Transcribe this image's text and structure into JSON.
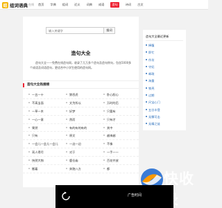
{
  "header": {
    "logo_mark": "组",
    "logo_text": "组词语典",
    "logo_sub": "在线",
    "nav": [
      {
        "label": "首页",
        "active": false
      },
      {
        "label": "字典",
        "active": false
      },
      {
        "label": "组词",
        "active": false
      },
      {
        "label": "近义",
        "active": false
      },
      {
        "label": "词典",
        "active": false
      },
      {
        "label": "成语",
        "active": false
      },
      {
        "label": "造句",
        "active": true
      },
      {
        "label": "诗词",
        "active": false
      },
      {
        "label": "古文",
        "active": false
      }
    ]
  },
  "search": {
    "placeholder": "输入关键字",
    "button_label": "搜词"
  },
  "main": {
    "title": "造句大全",
    "description": "造句大全——免费在线造句网，收录了几万多个造句及造句例句，包含5000多个成语及词语造句，更适合中小学生使用的造句网。",
    "section_title": "造句大全热搜榜",
    "rows": [
      [
        "一五一十",
        "狼吞虎",
        "卧心胆心"
      ],
      [
        "不离当面",
        "文为所以",
        "万时的后"
      ],
      [
        "一草一木",
        "好梦",
        "只要有"
      ],
      [
        "一心一意",
        "然而",
        "只有才"
      ],
      [
        "果然",
        "有的有的有的",
        "其中"
      ],
      [
        "只有",
        "原文",
        "越来越"
      ],
      [
        "一会儿一会儿一会儿",
        "一边一边",
        "不像"
      ],
      [
        "耳人得尽",
        "对于",
        "一手一一"
      ],
      [
        "快然大物",
        "鹿仓庙",
        "百花齐放"
      ],
      [
        "搬着",
        "奔跑八方",
        "都"
      ]
    ]
  },
  "sidebar": {
    "title": "造句大全最近更新",
    "items": [
      "捧腹",
      "即忙",
      "作坊",
      "守纪",
      "邮政",
      "海量",
      "铁壳",
      "过期",
      "尺宝心门",
      "五谷丰登",
      "无懈可击",
      "无精之徒"
    ]
  },
  "overlay": {
    "ad_label": "广告时间"
  },
  "watermark": {
    "text": "快收录"
  }
}
